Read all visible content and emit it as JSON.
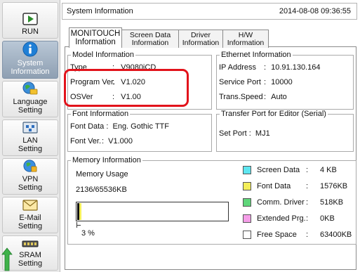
{
  "sidebar": {
    "items": [
      {
        "label_lines": [
          "RUN"
        ],
        "icon": "play-icon"
      },
      {
        "label_lines": [
          "System",
          "Information"
        ],
        "icon": "info-icon",
        "active": true
      },
      {
        "label_lines": [
          "Language",
          "Setting"
        ],
        "icon": "language-icon"
      },
      {
        "label_lines": [
          "LAN",
          "Setting"
        ],
        "icon": "lan-icon"
      },
      {
        "label_lines": [
          "VPN",
          "Setting"
        ],
        "icon": "vpn-icon"
      },
      {
        "label_lines": [
          "E-Mail",
          "Setting"
        ],
        "icon": "email-icon"
      },
      {
        "label_lines": [
          "SRAM",
          "Setting"
        ],
        "icon": "sram-icon"
      }
    ]
  },
  "header": {
    "title": "System Information",
    "datetime": "2014-08-08 09:36:55"
  },
  "tabs": [
    {
      "line1": "MONITOUCH",
      "line2": "Information",
      "active": true
    },
    {
      "line1": "Screen Data",
      "line2": "Information"
    },
    {
      "line1": "Driver",
      "line2": "Information"
    },
    {
      "line1": "H/W",
      "line2": "Information"
    }
  ],
  "model_info": {
    "title": "Model Information",
    "type_label": "Type",
    "type_value": "V9080iCD",
    "program_label": "Program Ver.",
    "program_value": "V1.020",
    "os_label": "OSVer",
    "os_value": "V1.00"
  },
  "ethernet_info": {
    "title": "Ethernet Information",
    "ip_label": "IP Address",
    "ip_value": "10.91.130.164",
    "port_label": "Service Port",
    "port_value": "10000",
    "speed_label": "Trans.Speed",
    "speed_value": "Auto"
  },
  "font_info": {
    "title": "Font Information",
    "data_label": "Font Data",
    "data_value": "Eng. Gothic TTF",
    "ver_label": "Font Ver.",
    "ver_value": "V1.000"
  },
  "transfer_port": {
    "title": "Transfer Port for Editor (Serial)",
    "set_label": "Set Port",
    "set_value": "MJ1"
  },
  "memory_info": {
    "title": "Memory Information",
    "usage_label": "Memory Usage",
    "usage_value": "2136/65536KB",
    "percent_label": "3 %",
    "used_fraction": 0.0326,
    "legend": [
      {
        "name": "Screen Data",
        "value": "4 KB",
        "color": "#5ee6f0"
      },
      {
        "name": "Font Data",
        "value": "1576KB",
        "color": "#f3ee5a"
      },
      {
        "name": "Comm. Driver",
        "value": "518KB",
        "color": "#5fd67a"
      },
      {
        "name": "Extended Prg.",
        "value": "0KB",
        "color": "#f59ee8"
      },
      {
        "name": "Free Space",
        "value": "63400KB",
        "color": "#ffffff"
      }
    ]
  }
}
